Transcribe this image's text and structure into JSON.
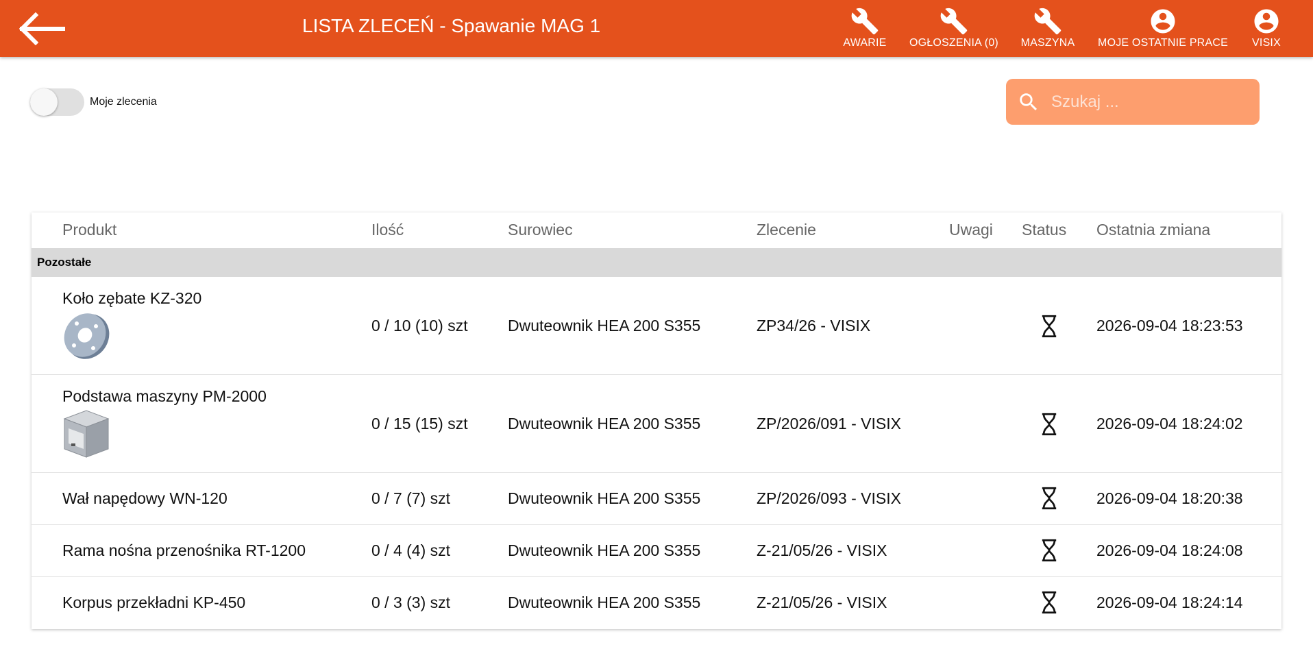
{
  "header": {
    "title": "LISTA ZLECEŃ - Spawanie MAG 1",
    "nav": [
      {
        "label": "AWARIE",
        "icon": "wrench-icon"
      },
      {
        "label": "OGŁOSZENIA (0)",
        "icon": "wrench-icon"
      },
      {
        "label": "MASZYNA",
        "icon": "wrench-icon"
      },
      {
        "label": "MOJE OSTATNIE PRACE",
        "icon": "account-icon"
      },
      {
        "label": "VISIX",
        "icon": "account-icon"
      }
    ],
    "color": "#e4511c"
  },
  "filter": {
    "toggle_label": "Moje zlecenia"
  },
  "search": {
    "placeholder": "Szukaj ..."
  },
  "table": {
    "columns": [
      "Produkt",
      "Ilość",
      "Surowiec",
      "Zlecenie",
      "Uwagi",
      "Status",
      "Ostatnia zmiana"
    ],
    "group": "Pozostałe",
    "rows": [
      {
        "product": "Koło zębate KZ-320",
        "qty": "0 / 10 (10) szt",
        "material": "Dwuteownik HEA 200 S355",
        "order": "ZP34/26 - VISIX",
        "notes": "",
        "status": "hourglass-icon",
        "changed": "2026-09-04 18:23:53"
      },
      {
        "product": "Podstawa maszyny PM-2000",
        "qty": "0 / 15 (15) szt",
        "material": "Dwuteownik HEA 200 S355",
        "order": "ZP/2026/091 - VISIX",
        "notes": "",
        "status": "hourglass-icon",
        "changed": "2026-09-04 18:24:02"
      },
      {
        "product": "Wał napędowy WN-120",
        "qty": "0 / 7 (7) szt",
        "material": "Dwuteownik HEA 200 S355",
        "order": "ZP/2026/093 - VISIX",
        "notes": "",
        "status": "hourglass-icon",
        "changed": "2026-09-04 18:20:38"
      },
      {
        "product": "Rama nośna przenośnika RT-1200",
        "qty": "0 / 4 (4) szt",
        "material": "Dwuteownik HEA 200 S355",
        "order": "Z-21/05/26 - VISIX",
        "notes": "",
        "status": "hourglass-icon",
        "changed": "2026-09-04 18:24:08"
      },
      {
        "product": "Korpus przekładni KP-450",
        "qty": "0 / 3 (3) szt",
        "material": "Dwuteownik HEA 200 S355",
        "order": "Z-21/05/26 - VISIX",
        "notes": "",
        "status": "hourglass-icon",
        "changed": "2026-09-04 18:24:14"
      }
    ]
  }
}
